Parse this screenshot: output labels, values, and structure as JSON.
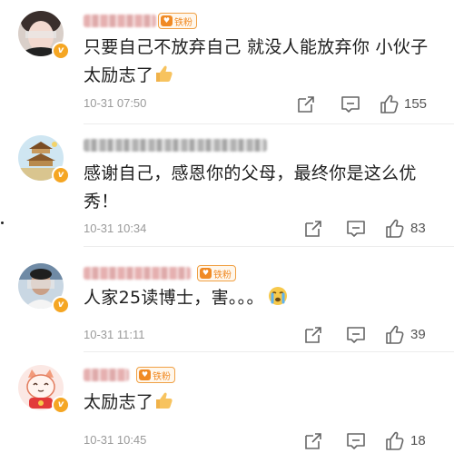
{
  "comments": [
    {
      "fans_label": "铁粉",
      "text": "只要自己不放弃自己 就没人能放弃你 小伙子太励志了",
      "time": "10-31 07:50",
      "likes": "155",
      "verified_label": "v"
    },
    {
      "fans_label": "",
      "text": "感谢自己，感恩你的父母，最终你是这么优秀！",
      "time": "10-31 10:34",
      "likes": "83",
      "verified_label": "v"
    },
    {
      "fans_label": "铁粉",
      "text": "人家25读博士，害。。。",
      "time": "10-31 11:11",
      "likes": "39",
      "verified_label": "v"
    },
    {
      "fans_label": "铁粉",
      "text": "太励志了",
      "time": "10-31 10:45",
      "likes": "18",
      "verified_label": "v"
    }
  ],
  "icons": {
    "share": "share-icon",
    "comment": "comment-icon",
    "like": "thumbs-up-icon",
    "emoji_thumbs": "thumbs-up-emoji",
    "emoji_cry": "crying-emoji"
  },
  "colors": {
    "badge": "#f5a623",
    "fans": "#f08a24",
    "time": "#9a9a9a"
  }
}
